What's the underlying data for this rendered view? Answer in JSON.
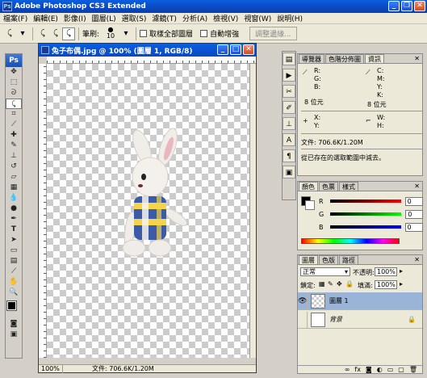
{
  "app": {
    "title": "Adobe Photoshop CS3 Extended"
  },
  "menu": [
    "檔案(F)",
    "編輯(E)",
    "影像(I)",
    "圖層(L)",
    "選取(S)",
    "濾鏡(T)",
    "分析(A)",
    "檢視(V)",
    "視窗(W)",
    "說明(H)"
  ],
  "options": {
    "brush_label": "筆刷:",
    "brush_size": "10",
    "sample_all_label": "取樣全部圖層",
    "auto_enhance_label": "自動增強",
    "refine_edge_label": "調整邊緣..."
  },
  "toolbox": {
    "logo": "Ps",
    "tools": [
      "move",
      "marquee",
      "lasso",
      "quick-selection",
      "crop",
      "slice",
      "healing",
      "brush",
      "clone-stamp",
      "history-brush",
      "eraser",
      "gradient",
      "blur",
      "dodge",
      "pen",
      "type",
      "path-selection",
      "shape",
      "notes",
      "eyedropper",
      "hand",
      "zoom"
    ]
  },
  "document": {
    "title": "兔子布偶.jpg @ 100% (圖層 1, RGB/8)",
    "zoom": "100%",
    "status": "文件: 706.6K/1.20M"
  },
  "info_panel": {
    "tabs": [
      "導覽器",
      "色階分佈圖",
      "資訊"
    ],
    "active_tab": "資訊",
    "rgb": [
      "R:",
      "G:",
      "B:"
    ],
    "cmyk": [
      "C:",
      "M:",
      "Y:",
      "K:"
    ],
    "bit_left": "8 位元",
    "bit_right": "8 位元",
    "xy": [
      "X:",
      "Y:"
    ],
    "wh": [
      "W:",
      "H:"
    ],
    "doc_size": "文件: 706.6K/1.20M",
    "hint": "從已存在的選取範圍中減去。"
  },
  "color_panel": {
    "tabs": [
      "顏色",
      "色票",
      "樣式"
    ],
    "active_tab": "顏色",
    "channels": [
      {
        "label": "R",
        "value": "0"
      },
      {
        "label": "G",
        "value": "0"
      },
      {
        "label": "B",
        "value": "0"
      }
    ]
  },
  "layers_panel": {
    "tabs": [
      "圖層",
      "色版",
      "路徑"
    ],
    "active_tab": "圖層",
    "blend_mode": "正常",
    "opacity_label": "不透明:",
    "opacity_value": "100%",
    "lock_label": "鎖定:",
    "fill_label": "填滿:",
    "fill_value": "100%",
    "layers": [
      {
        "name": "圖層 1",
        "selected": true
      },
      {
        "name": "背景",
        "selected": false
      }
    ]
  },
  "colors": {
    "titlebar": "#0b48c2",
    "selection": "#9ab4d8"
  }
}
